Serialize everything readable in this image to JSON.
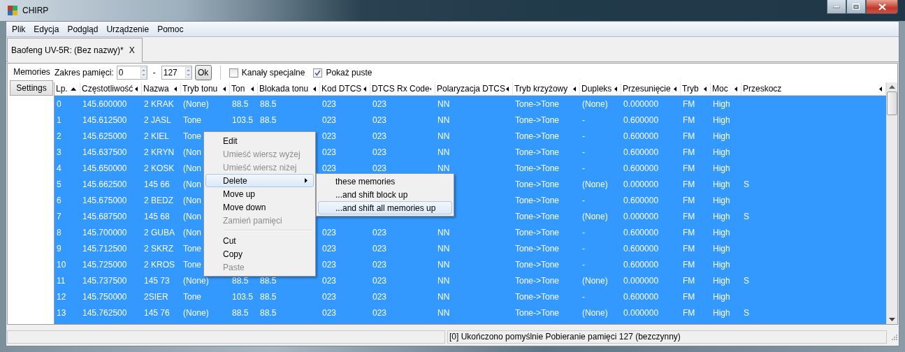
{
  "window": {
    "title": "CHIRP"
  },
  "menu_bar": [
    "Plik",
    "Edycja",
    "Podgląd",
    "Urządzenie",
    "Pomoc"
  ],
  "tabs": [
    {
      "label": "Baofeng UV-5R: (Bez nazwy)*",
      "close": "X",
      "selected": true
    }
  ],
  "side_tabs": [
    {
      "label": "Memories",
      "selected": true
    },
    {
      "label": "Settings",
      "selected": false
    }
  ],
  "toolbar": {
    "range_label": "Zakres pamięci:",
    "range_start": "0",
    "dash": "-",
    "range_end": "127",
    "ok_button": "Ok",
    "checkboxes": [
      {
        "label": "Kanały specjalne",
        "checked": false
      },
      {
        "label": "Pokaż puste",
        "checked": true
      }
    ]
  },
  "table": {
    "columns": [
      {
        "label": "Lp.",
        "sorted": true
      },
      {
        "label": "Częstotliwość",
        "sorted": false
      },
      {
        "label": "Nazwa",
        "sorted": false
      },
      {
        "label": "Tryb tonu",
        "sorted": false
      },
      {
        "label": "Ton",
        "sorted": false
      },
      {
        "label": "Blokada tonu",
        "sorted": false
      },
      {
        "label": "Kod DTCS",
        "sorted": false
      },
      {
        "label": "DTCS Rx Code",
        "sorted": false
      },
      {
        "label": "Polaryzacja DTCS",
        "sorted": false
      },
      {
        "label": "Tryb krzyżowy",
        "sorted": false
      },
      {
        "label": "Dupleks",
        "sorted": false
      },
      {
        "label": "Przesunięcie",
        "sorted": false
      },
      {
        "label": "Tryb",
        "sorted": false
      },
      {
        "label": "Moc",
        "sorted": false
      },
      {
        "label": "Przeskocz",
        "sorted": false
      }
    ],
    "rows": [
      {
        "selected": true,
        "cells": [
          "0",
          "145.600000",
          "2 KRAK",
          "(None)",
          "88.5",
          "88.5",
          "023",
          "023",
          "NN",
          "Tone->Tone",
          "(None)",
          "0.000000",
          "FM",
          "High",
          null
        ]
      },
      {
        "selected": true,
        "cells": [
          "1",
          "145.612500",
          "2 JASL",
          "Tone",
          "103.5",
          "88.5",
          "023",
          "023",
          "NN",
          "Tone->Tone",
          "-",
          "0.600000",
          "FM",
          "High",
          null
        ]
      },
      {
        "selected": true,
        "cells": [
          "2",
          "145.625000",
          "2 KIEL",
          "Tone",
          null,
          null,
          "023",
          "023",
          "NN",
          "Tone->Tone",
          "-",
          "0.600000",
          "FM",
          "High",
          null
        ]
      },
      {
        "selected": true,
        "cells": [
          "3",
          "145.637500",
          "2 KRYN",
          "(Non",
          null,
          null,
          "023",
          "023",
          "NN",
          "Tone->Tone",
          "-",
          "0.600000",
          "FM",
          "High",
          null
        ]
      },
      {
        "selected": true,
        "cells": [
          "4",
          "145.650000",
          "2 KOSK",
          "(Non",
          null,
          null,
          "023",
          "023",
          "NN",
          "Tone->Tone",
          "-",
          "0.600000",
          "FM",
          "High",
          null
        ]
      },
      {
        "selected": true,
        "cells": [
          "5",
          "145.662500",
          "145 66",
          "(Non",
          null,
          null,
          null,
          null,
          null,
          "Tone->Tone",
          "(None)",
          "0.000000",
          "FM",
          "High",
          "S"
        ]
      },
      {
        "selected": true,
        "cells": [
          "6",
          "145.675000",
          "2 BEDZ",
          "(Non",
          null,
          null,
          null,
          null,
          null,
          "Tone->Tone",
          "-",
          "0.600000",
          "FM",
          "High",
          null
        ]
      },
      {
        "selected": true,
        "cells": [
          "7",
          "145.687500",
          "145 68",
          "(Non",
          null,
          null,
          null,
          null,
          null,
          "Tone->Tone",
          "(None)",
          "0.000000",
          "FM",
          "High",
          "S"
        ]
      },
      {
        "selected": true,
        "cells": [
          "8",
          "145.700000",
          "2 GUBA",
          "(Non",
          null,
          null,
          "023",
          "023",
          "NN",
          "Tone->Tone",
          "-",
          "0.600000",
          "FM",
          "High",
          null
        ]
      },
      {
        "selected": true,
        "cells": [
          "9",
          "145.712500",
          "2 SKRZ",
          "Tone",
          null,
          null,
          "023",
          "023",
          "NN",
          "Tone->Tone",
          "-",
          "0.600000",
          "FM",
          "High",
          null
        ]
      },
      {
        "selected": true,
        "cells": [
          "10",
          "145.725000",
          "2 KROS",
          "Tone",
          null,
          null,
          "023",
          "023",
          "NN",
          "Tone->Tone",
          "-",
          "0.600000",
          "FM",
          "High",
          null
        ]
      },
      {
        "selected": true,
        "cells": [
          "11",
          "145.737500",
          "145 73",
          "(None)",
          "88.5",
          "88.5",
          "023",
          "023",
          "NN",
          "Tone->Tone",
          "(None)",
          "0.000000",
          "FM",
          "High",
          "S"
        ]
      },
      {
        "selected": true,
        "cells": [
          "12",
          "145.750000",
          "2SIER",
          "Tone",
          "103.5",
          "88.5",
          "023",
          "023",
          "NN",
          "Tone->Tone",
          "-",
          "0.600000",
          "FM",
          "High",
          null
        ]
      },
      {
        "selected": true,
        "cells": [
          "13",
          "145.762500",
          "145 76",
          "(None)",
          "88.5",
          "88.5",
          "023",
          "023",
          "NN",
          "Tone->Tone",
          "(None)",
          "0.000000",
          "FM",
          "High",
          "S"
        ]
      }
    ]
  },
  "context_menu": {
    "items": [
      {
        "kind": "item",
        "label": "Edit",
        "disabled": false,
        "selected": false
      },
      {
        "kind": "item",
        "label": "Umieść wiersz wyżej",
        "disabled": true,
        "selected": false
      },
      {
        "kind": "item",
        "label": "Umieść wiersz niżej",
        "disabled": true,
        "selected": false
      },
      {
        "kind": "submenu",
        "label": "Delete",
        "disabled": false,
        "selected": true
      },
      {
        "kind": "item",
        "label": "Move up",
        "disabled": false,
        "selected": false
      },
      {
        "kind": "item",
        "label": "Move down",
        "disabled": false,
        "selected": false
      },
      {
        "kind": "item",
        "label": "Zamień pamięci",
        "disabled": true,
        "selected": false
      },
      {
        "kind": "separator"
      },
      {
        "kind": "item",
        "label": "Cut",
        "disabled": false,
        "selected": false
      },
      {
        "kind": "item",
        "label": "Copy",
        "disabled": false,
        "selected": false
      },
      {
        "kind": "item",
        "label": "Paste",
        "disabled": true,
        "selected": false
      }
    ]
  },
  "submenu": {
    "items": [
      {
        "label": "these memories",
        "selected": false
      },
      {
        "label": "...and shift block up",
        "selected": false
      },
      {
        "label": "...and shift all memories up",
        "selected": true
      }
    ]
  },
  "status_bar": {
    "message": "[0] Ukończono pomyślnie Pobieranie pamięci 127 (bezczynny)"
  }
}
